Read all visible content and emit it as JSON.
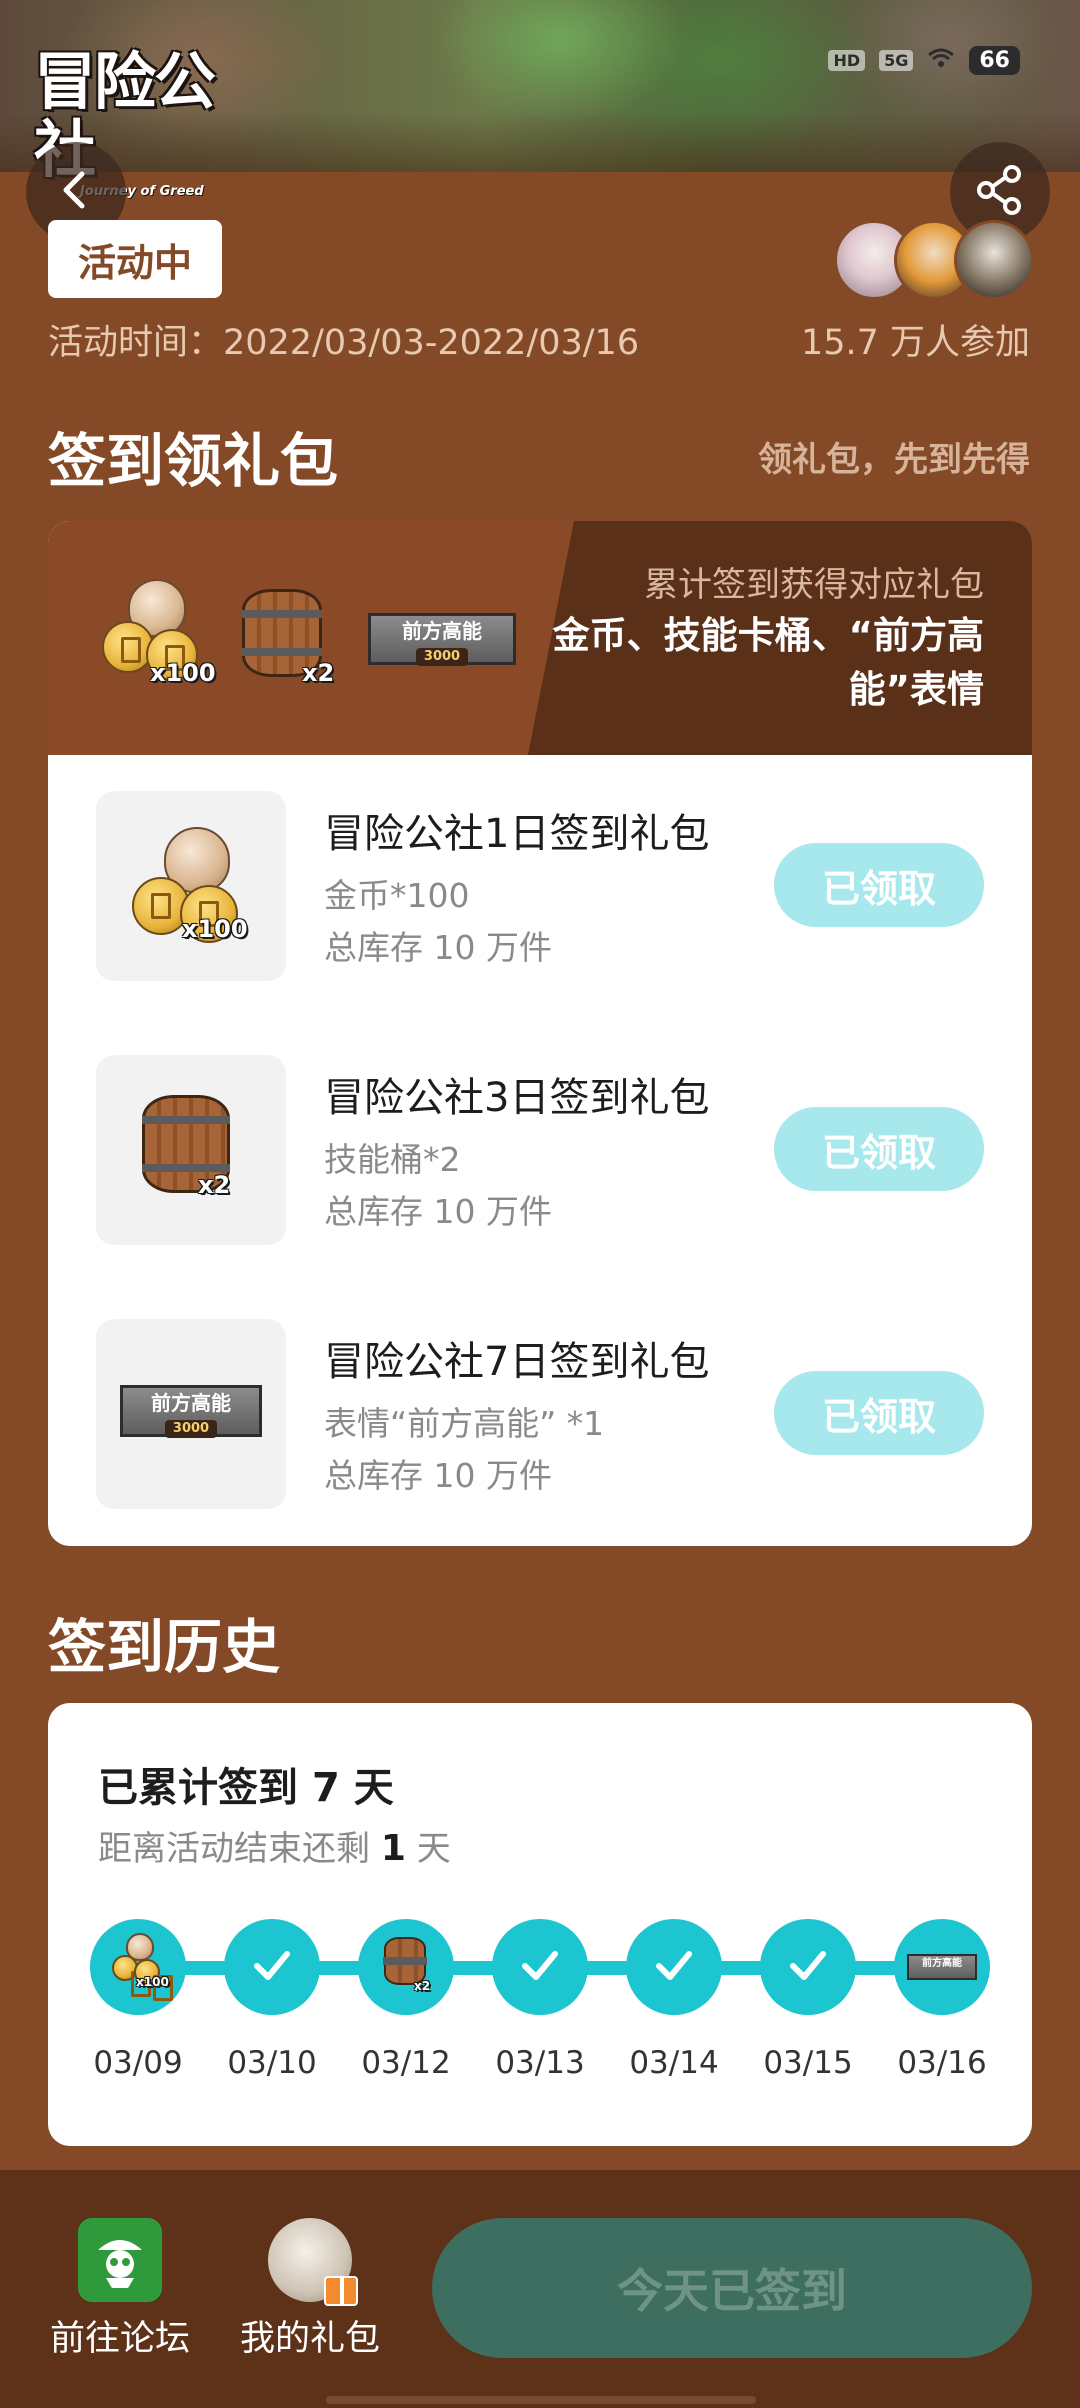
{
  "banner": {
    "logo_main": "冒险公社",
    "logo_sub": "Journey of Greed",
    "status_hd": "HD",
    "status_net": "5G",
    "battery": "66"
  },
  "activity": {
    "status": "活动中",
    "time": "活动时间：2022/03/03-2022/03/16",
    "participants": "15.7 万人参加"
  },
  "signin_section": {
    "title": "签到领礼包",
    "hint": "领礼包，先到先得",
    "header_sub": "累计签到获得对应礼包",
    "header_main": "金币、技能卡桶、“前方高能”表情",
    "badge_text": "前方高能",
    "badge_value": "3000",
    "coin_mult": "x100",
    "barrel_mult": "x2",
    "rewards": [
      {
        "title": "冒险公社1日签到礼包",
        "desc": "金币*100",
        "stock": "总库存 10 万件",
        "button": "已领取",
        "icon": "coin-bag-icon",
        "mult": "x100"
      },
      {
        "title": "冒险公社3日签到礼包",
        "desc": "技能桶*2",
        "stock": "总库存 10 万件",
        "button": "已领取",
        "icon": "barrel-icon",
        "mult": "x2"
      },
      {
        "title": "冒险公社7日签到礼包",
        "desc": "表情“前方高能” *1",
        "stock": "总库存 10 万件",
        "button": "已领取",
        "icon": "emote-badge-icon",
        "badge": "前方高能",
        "badge_value": "3000"
      }
    ]
  },
  "history": {
    "title": "签到历史",
    "total_prefix": "已累计签到",
    "total_days": "7",
    "total_suffix": "天",
    "remain_prefix": "距离活动结束还剩",
    "remain_days": "1",
    "remain_suffix": "天",
    "days": [
      {
        "date": "03/09",
        "icon": "coin-bag-icon",
        "mult": "x100"
      },
      {
        "date": "03/10",
        "icon": "check-icon"
      },
      {
        "date": "03/12",
        "icon": "barrel-icon",
        "mult": "x2"
      },
      {
        "date": "03/13",
        "icon": "check-icon"
      },
      {
        "date": "03/14",
        "icon": "check-icon"
      },
      {
        "date": "03/15",
        "icon": "check-icon"
      },
      {
        "date": "03/16",
        "icon": "emote-badge-icon",
        "badge": "前方高能"
      }
    ]
  },
  "bottom": {
    "forum_label": "前往论坛",
    "gifts_label": "我的礼包",
    "signin_button": "今天已签到"
  },
  "colors": {
    "background": "#844a27",
    "accent_teal": "#1cc5cf",
    "claimed_button": "#a6e8ec",
    "signin_button": "#3e6e5f",
    "bottom_bar": "#5e3219"
  }
}
